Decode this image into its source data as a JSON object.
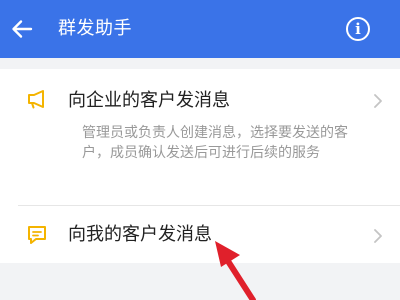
{
  "header": {
    "title": "群发助手",
    "back_icon": "arrow-left-icon",
    "info_icon": "info-circle-icon",
    "background": "#3a73e8"
  },
  "items": [
    {
      "title": "向企业的客户发消息",
      "description": "管理员或负责人创建消息，选择要发送的客户，成员确认发送后可进行后续的服务",
      "icon": "megaphone-icon",
      "icon_color": "#f4b400"
    },
    {
      "title": "向我的客户发消息",
      "icon": "chat-bubble-icon",
      "icon_color": "#f4b400"
    }
  ],
  "annotation": {
    "arrow_color": "#e0202b"
  }
}
